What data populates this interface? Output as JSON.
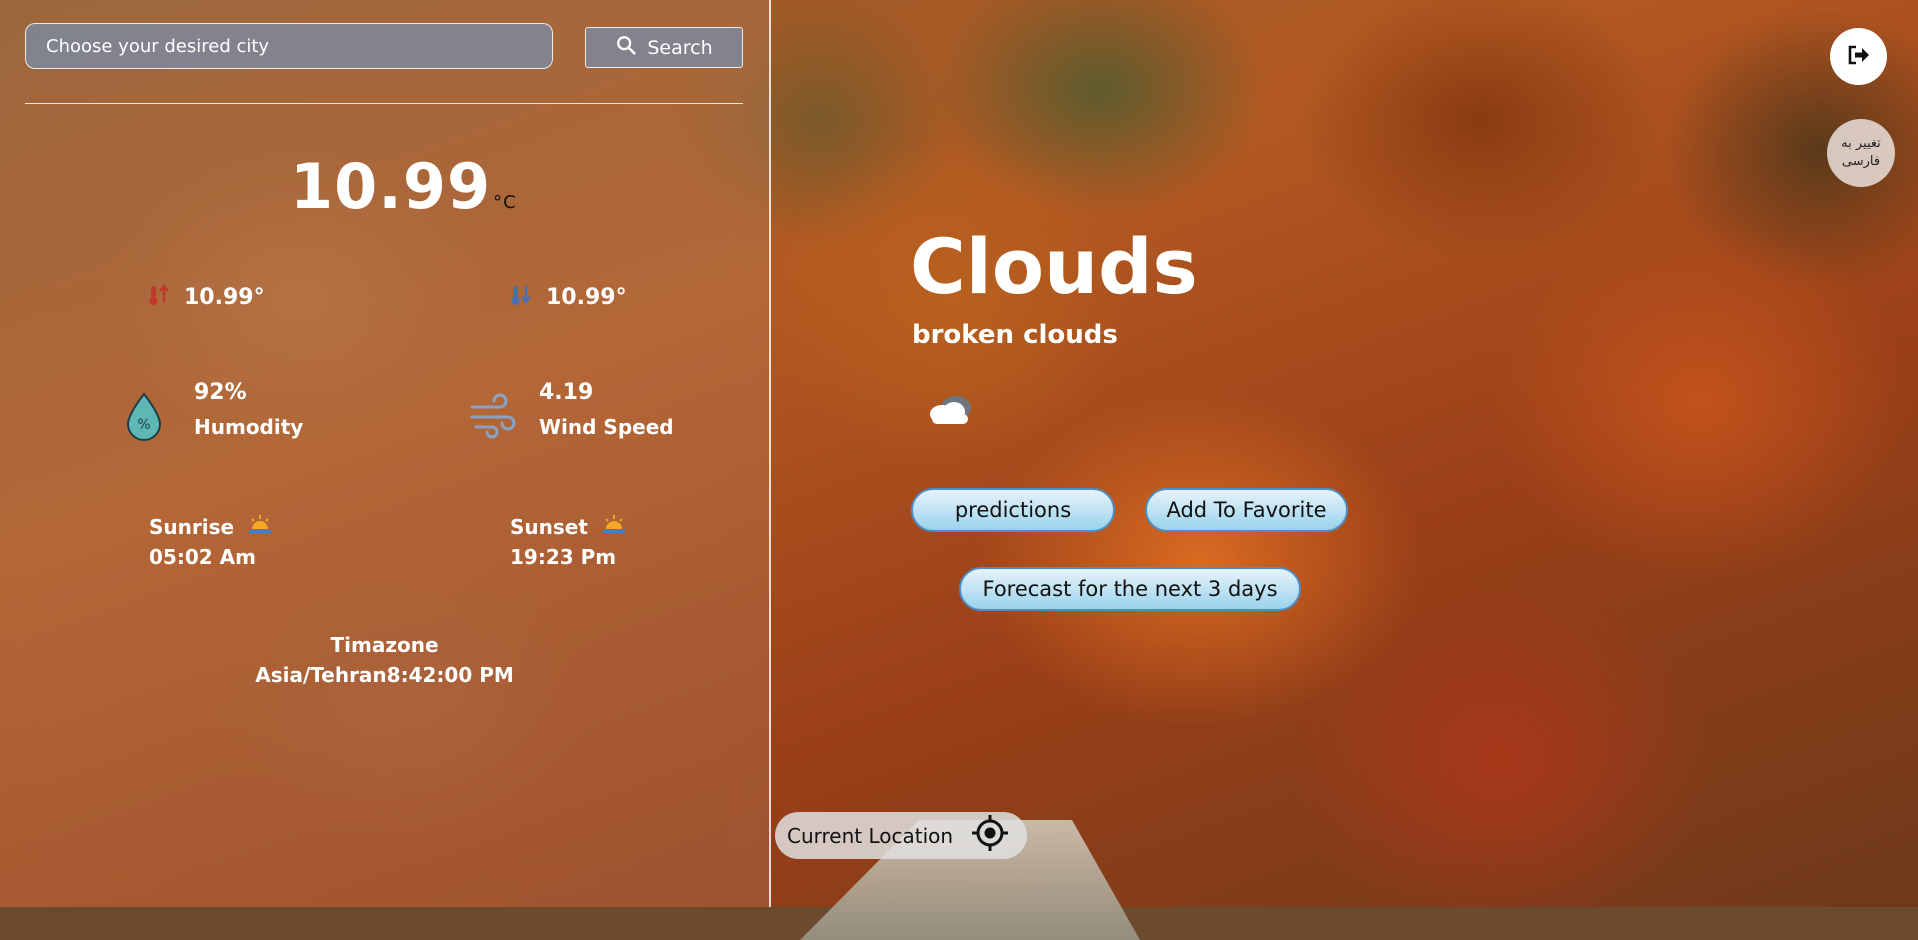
{
  "search": {
    "placeholder": "Choose your desired city",
    "button_label": "Search"
  },
  "current": {
    "temperature": "10.99",
    "unit": "°C",
    "temp_max": "10.99°",
    "temp_min": "10.99°",
    "humidity_value": "92%",
    "humidity_label": "Humodity",
    "wind_value": "4.19",
    "wind_label": "Wind Speed",
    "sunrise_label": "Sunrise",
    "sunrise_time": "05:02 Am",
    "sunset_label": "Sunset",
    "sunset_time": "19:23 Pm",
    "timezone_label": "Timazone",
    "timezone_value": "Asia/Tehran8:42:00 PM"
  },
  "condition": {
    "main": "Clouds",
    "description": "broken clouds"
  },
  "actions": {
    "predictions": "predictions",
    "favorite": "Add To Favorite",
    "forecast": "Forecast for the next 3 days",
    "current_location": "Current Location",
    "language_toggle": "تغییر به فارسی"
  },
  "icons": {
    "search": "search-icon",
    "temp_max": "thermometer-up-icon",
    "temp_min": "thermometer-down-icon",
    "humidity": "droplet-icon",
    "wind": "wind-icon",
    "sunrise": "sunrise-icon",
    "sunset": "sunset-icon",
    "condition": "cloud-icon",
    "logout": "logout-icon",
    "location": "crosshair-icon"
  },
  "colors": {
    "pill_border": "#4a8fc6",
    "pill_fill_top": "#e7f3fa",
    "pill_fill_bottom": "#9ad3ec",
    "input_fill": "#788caa"
  }
}
